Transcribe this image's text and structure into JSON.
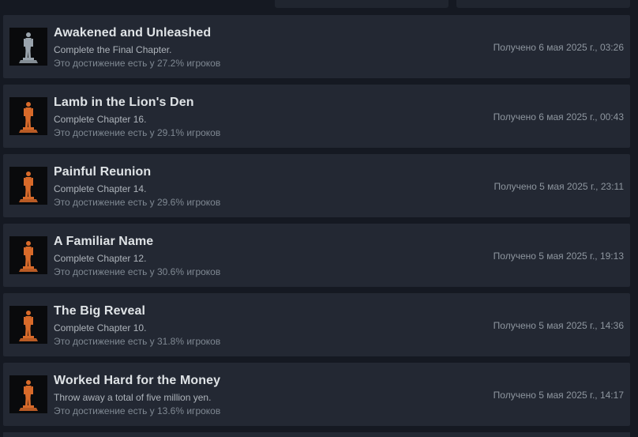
{
  "achievements": [
    {
      "title": "Awakened and Unleashed",
      "description": "Complete the Final Chapter.",
      "percent_text": "Это достижение есть у 27.2% игроков",
      "unlocked": "Получено 6 мая 2025 г., 03:26",
      "icon": "silver-statue-icon",
      "icon_color": "#9aa4ad"
    },
    {
      "title": "Lamb in the Lion's Den",
      "description": "Complete Chapter 16.",
      "percent_text": "Это достижение есть у 29.1% игроков",
      "unlocked": "Получено 6 мая 2025 г., 00:43",
      "icon": "bronze-statue-icon",
      "icon_color": "#d86a2a"
    },
    {
      "title": "Painful Reunion",
      "description": "Complete Chapter 14.",
      "percent_text": "Это достижение есть у 29.6% игроков",
      "unlocked": "Получено 5 мая 2025 г., 23:11",
      "icon": "bronze-statue-icon",
      "icon_color": "#d86a2a"
    },
    {
      "title": "A Familiar Name",
      "description": "Complete Chapter 12.",
      "percent_text": "Это достижение есть у 30.6% игроков",
      "unlocked": "Получено 5 мая 2025 г., 19:13",
      "icon": "bronze-statue-icon",
      "icon_color": "#d86a2a"
    },
    {
      "title": "The Big Reveal",
      "description": "Complete Chapter 10.",
      "percent_text": "Это достижение есть у 31.8% игроков",
      "unlocked": "Получено 5 мая 2025 г., 14:36",
      "icon": "bronze-statue-icon",
      "icon_color": "#d86a2a"
    },
    {
      "title": "Worked Hard for the Money",
      "description": "Throw away a total of five million yen.",
      "percent_text": "Это достижение есть у 13.6% игроков",
      "unlocked": "Получено 5 мая 2025 г., 14:17",
      "icon": "bronze-statue-icon",
      "icon_color": "#d86a2a"
    }
  ]
}
